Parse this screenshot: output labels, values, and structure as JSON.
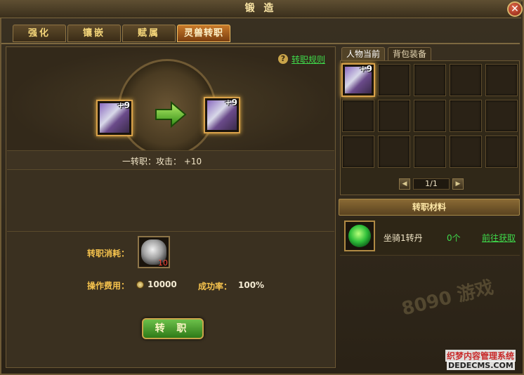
{
  "window": {
    "title": "锻 造",
    "close_label": "✕"
  },
  "tabs": [
    {
      "label": "强化",
      "active": false
    },
    {
      "label": "镶嵌",
      "active": false
    },
    {
      "label": "赋属",
      "active": false
    },
    {
      "label": "灵兽转职",
      "active": true
    }
  ],
  "help": {
    "icon": "?",
    "rules_link": "转职规则"
  },
  "transfer": {
    "source_item_level": "+9",
    "target_item_level": "+9",
    "stat_line": "一转职：攻击：   +10"
  },
  "cost": {
    "consume_label": "转职消耗：",
    "consume_count": "10",
    "fee_label": "操作费用：",
    "fee_value": "10000",
    "rate_label": "成功率：",
    "rate_value": "100%"
  },
  "action_button": "转 职",
  "right_tabs": [
    {
      "label": "人物当前",
      "active": true
    },
    {
      "label": "背包装备",
      "active": false
    }
  ],
  "inventory": {
    "first_item_level": "+9",
    "pager": "1/1",
    "prev_icon": "◀",
    "next_icon": "▶"
  },
  "materials": {
    "header": "转职材料",
    "item_name": "坐骑1转丹",
    "item_count": "0个",
    "get_link": "前往获取"
  },
  "watermarks": {
    "site_logo": "8090 游戏",
    "cms_line1": "织梦内容管理系统",
    "cms_line2": "DEDECMS.COM"
  },
  "colors": {
    "gold_text": "#f5c24d",
    "green_link": "#3fd94b",
    "active_tab": "#c97a2a"
  }
}
